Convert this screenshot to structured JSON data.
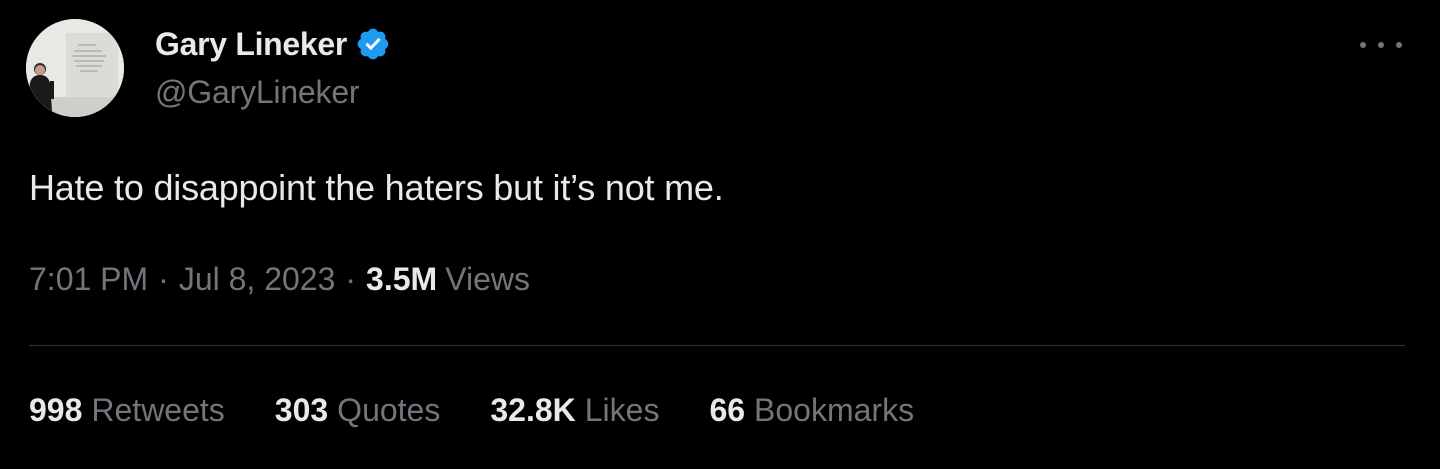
{
  "author": {
    "display_name": "Gary Lineker",
    "handle": "@GaryLineker",
    "verified": true
  },
  "tweet": {
    "text": "Hate to disappoint the haters but it’s not me.",
    "time": "7:01 PM",
    "date": "Jul 8, 2023",
    "separator": "·",
    "views_count": "3.5M",
    "views_label": "Views"
  },
  "stats": [
    {
      "count": "998",
      "label": "Retweets"
    },
    {
      "count": "303",
      "label": "Quotes"
    },
    {
      "count": "32.8K",
      "label": "Likes"
    },
    {
      "count": "66",
      "label": "Bookmarks"
    }
  ],
  "icons": {
    "verified": "verified-badge-icon",
    "more": "more-horizontal-icon"
  },
  "colors": {
    "background": "#000000",
    "primary_text": "#e7e9ea",
    "secondary_text": "#71767b",
    "divider": "#2f3336",
    "verified_blue": "#1d9bf0"
  }
}
